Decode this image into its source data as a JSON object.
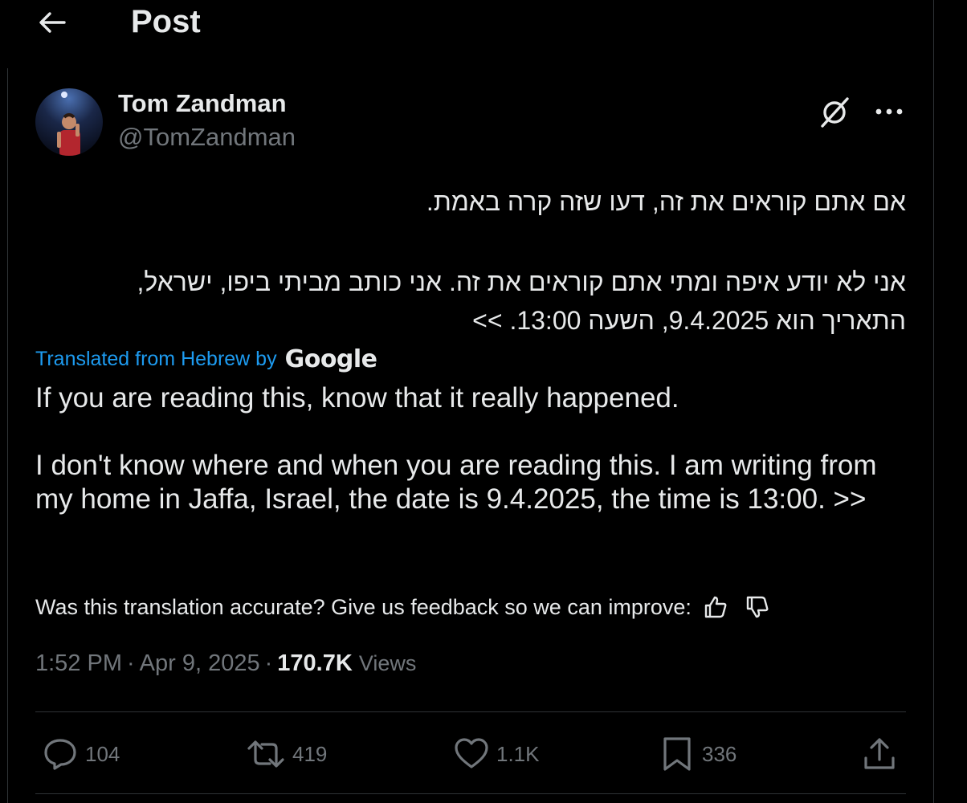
{
  "header": {
    "title": "Post",
    "back_icon": "arrow-left-icon"
  },
  "post": {
    "author": {
      "name": "Tom Zandman",
      "handle": "@TomZandman"
    },
    "hebrew": {
      "line1": "אם אתם קוראים את זה, דעו שזה קרה באמת.",
      "line2": "אני לא יודע איפה ומתי אתם קוראים את זה. אני כותב מביתי ביפו, ישראל,",
      "line3": "התאריך הוא 9.4.2025, השעה 13:00. >>"
    },
    "translation": {
      "label": "Translated from Hebrew by",
      "provider": "Google",
      "paragraph1": "If you are reading this, know that it really happened.",
      "paragraph2": "I don't know where and when you are reading this. I am writing from my home in Jaffa, Israel, the date is 9.4.2025, the time is 13:00. >>"
    },
    "feedback": {
      "prompt": "Was this translation accurate? Give us feedback so we can improve:"
    },
    "meta": {
      "time": "1:52 PM",
      "separator": "·",
      "date": "Apr 9, 2025",
      "views_count": "170.7K",
      "views_label": "Views"
    },
    "actions": {
      "replies": "104",
      "reposts": "419",
      "likes": "1.1K",
      "bookmarks": "336"
    }
  },
  "colors": {
    "background": "#000000",
    "text_primary": "#e7e9ea",
    "text_secondary": "#71767b",
    "accent": "#1d9bf0",
    "border": "#2f3336"
  }
}
